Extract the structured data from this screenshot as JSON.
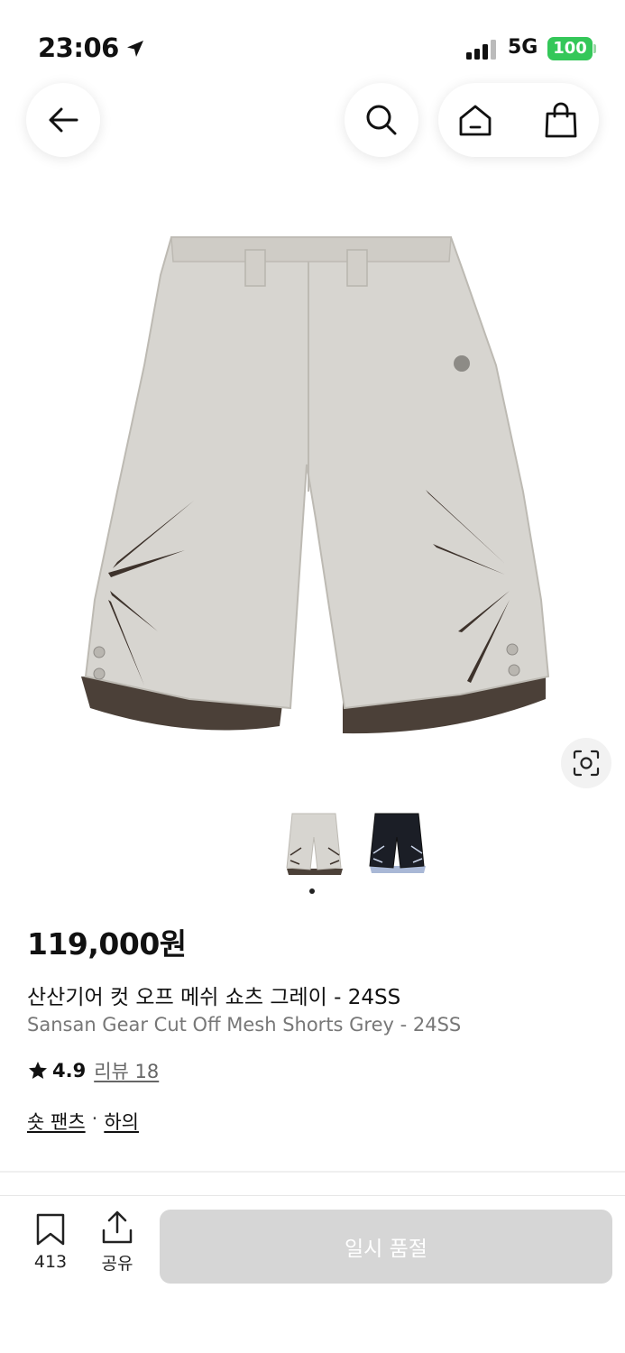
{
  "status_bar": {
    "time": "23:06",
    "network": "5G",
    "battery": "100",
    "battery_color": "#34c759"
  },
  "nav": {
    "back_icon": "arrow-left-icon",
    "search_icon": "search-icon",
    "home_icon": "home-icon",
    "cart_icon": "shopping-bag-icon"
  },
  "product": {
    "price": "119,000원",
    "title_ko": "산산기어 컷 오프 메쉬 쇼츠 그레이 - 24SS",
    "title_en": "Sansan Gear Cut Off Mesh Shorts Grey - 24SS",
    "rating": "4.9",
    "review_label": "리뷰 18",
    "categories": [
      "숏 팬츠",
      "하의"
    ],
    "category_separator": "·",
    "image_count": 2,
    "active_image": 1,
    "colors": [
      "grey",
      "black"
    ]
  },
  "bottom_bar": {
    "save_count": "413",
    "share_label": "공유",
    "soldout_label": "일시 품절"
  }
}
